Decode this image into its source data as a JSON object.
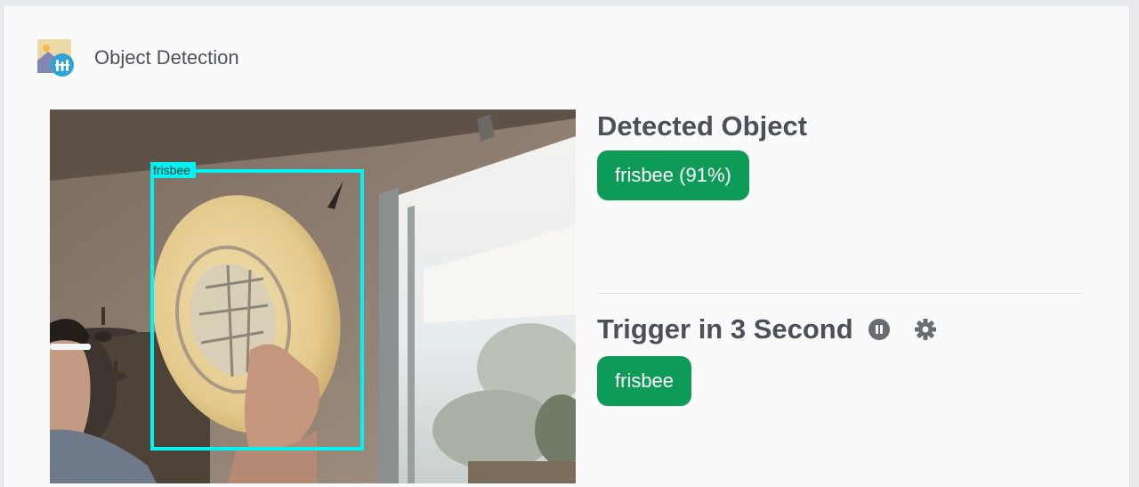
{
  "app": {
    "title": "Object Detection",
    "icon": "object-detection-app-icon"
  },
  "camera": {
    "bbox_label": "frisbee"
  },
  "detected": {
    "heading": "Detected Object",
    "result": "frisbee (91%)"
  },
  "trigger": {
    "heading": "Trigger in 3 Second",
    "pause_icon": "pause-icon",
    "settings_icon": "gear-icon",
    "label": "frisbee"
  },
  "colors": {
    "accent_green": "#0e9b58",
    "bbox_cyan": "#00f2f2"
  }
}
